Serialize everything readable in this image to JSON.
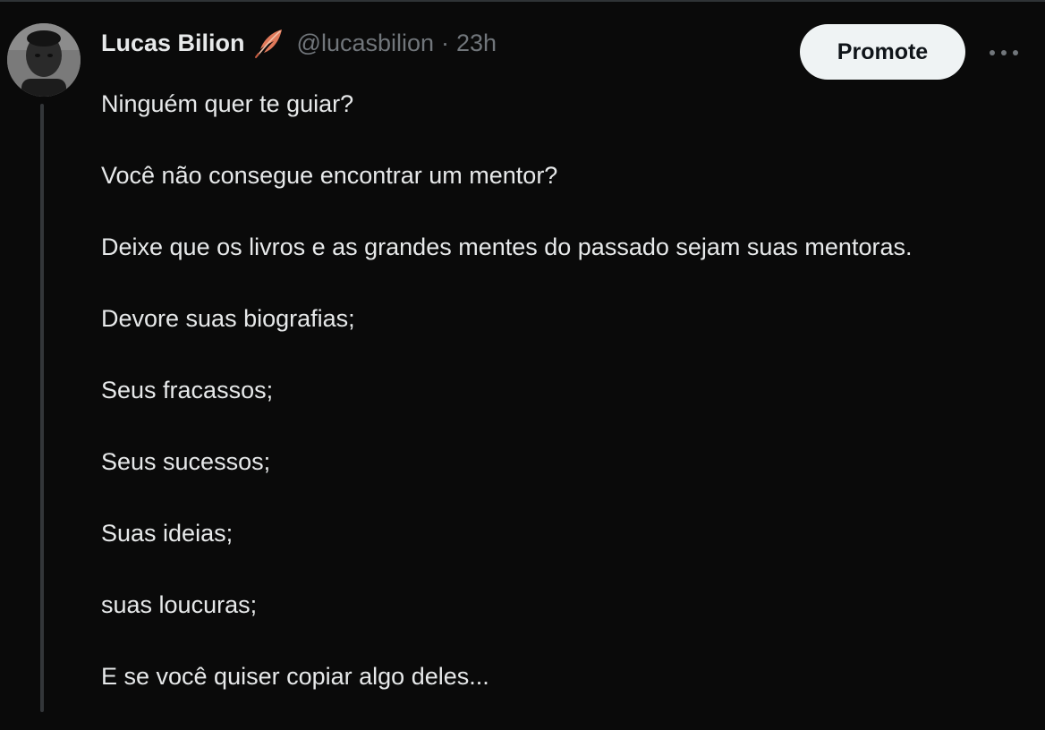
{
  "author": {
    "display_name": "Lucas Bilion",
    "handle": "@lucasbilion",
    "separator": "·",
    "time": "23h",
    "badge_icon": "feather-icon"
  },
  "actions": {
    "promote_label": "Promote",
    "more_icon": "more-icon"
  },
  "tweet": {
    "lines": [
      "Ninguém quer te guiar?",
      "Você não consegue encontrar um mentor?",
      "Deixe que os livros e as grandes mentes do passado sejam suas mentoras.",
      "Devore suas biografias;",
      "Seus fracassos;",
      "Seus sucessos;",
      "Suas ideias;",
      "suas loucuras;",
      "E se você quiser copiar algo deles..."
    ]
  },
  "colors": {
    "background": "#0a0a0a",
    "text": "#e7e9ea",
    "muted": "#71767b",
    "button_bg": "#eff3f4",
    "thread_line": "#333639"
  }
}
